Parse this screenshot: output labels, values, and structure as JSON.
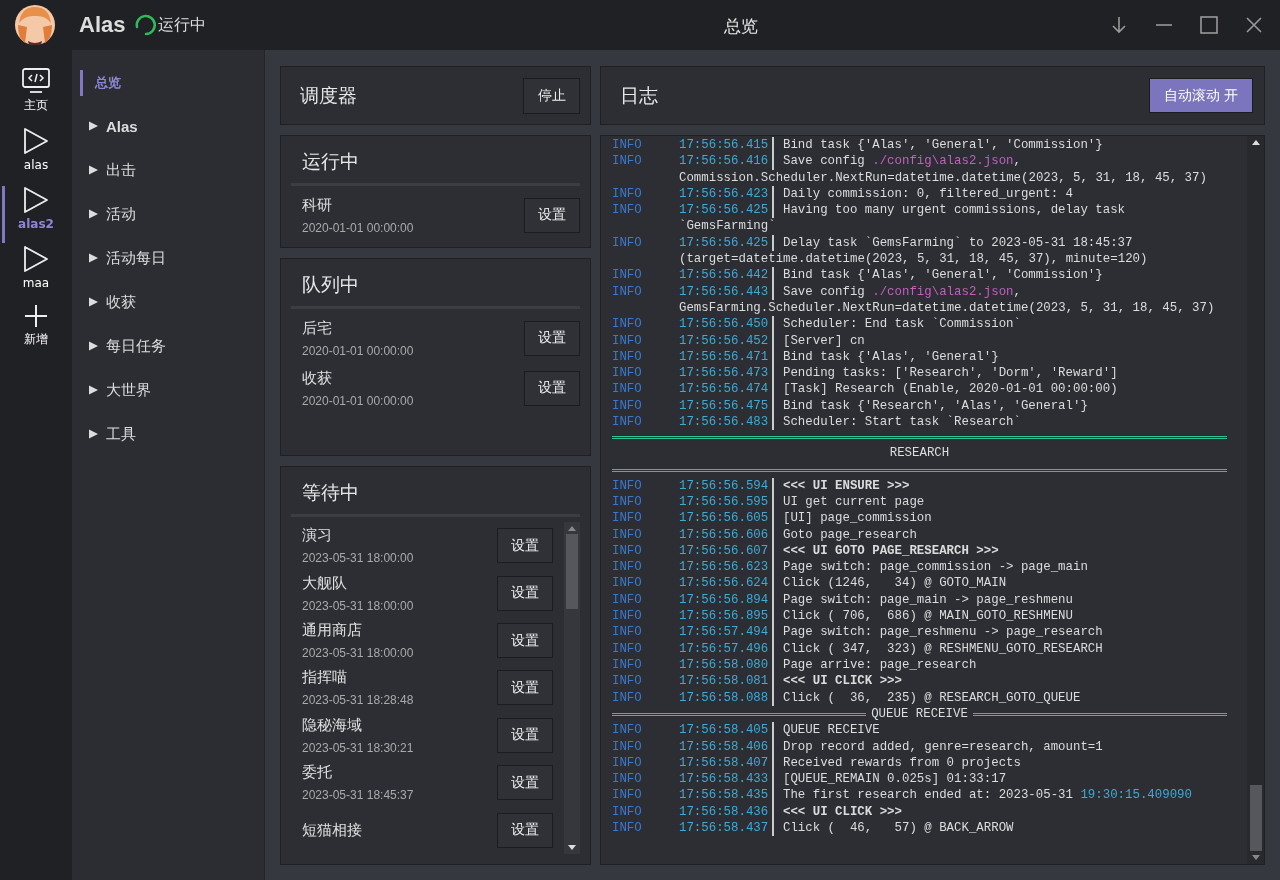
{
  "app": {
    "name": "Alas",
    "status": "运行中",
    "running": true
  },
  "window": {
    "title": "总览"
  },
  "rail": [
    {
      "label": "主页",
      "kind": "home",
      "selected": false
    },
    {
      "label": "alas",
      "kind": "instance",
      "selected": false
    },
    {
      "label": "alas2",
      "kind": "instance",
      "selected": true
    },
    {
      "label": "maa",
      "kind": "instance",
      "selected": false
    },
    {
      "label": "新增",
      "kind": "add",
      "selected": false
    }
  ],
  "nav": [
    {
      "label": "总览",
      "kind": "page",
      "selected": true
    },
    {
      "label": "Alas",
      "kind": "group",
      "selected": false
    },
    {
      "label": "出击",
      "kind": "group",
      "selected": false
    },
    {
      "label": "活动",
      "kind": "group",
      "selected": false
    },
    {
      "label": "活动每日",
      "kind": "group",
      "selected": false
    },
    {
      "label": "收获",
      "kind": "group",
      "selected": false
    },
    {
      "label": "每日任务",
      "kind": "group",
      "selected": false
    },
    {
      "label": "大世界",
      "kind": "group",
      "selected": false
    },
    {
      "label": "工具",
      "kind": "group",
      "selected": false
    }
  ],
  "scheduler": {
    "title": "调度器",
    "button": "停止"
  },
  "running": {
    "title": "运行中",
    "tasks": [
      {
        "name": "科研",
        "time": "2020-01-01 00:00:00",
        "button": "设置"
      }
    ]
  },
  "pending": {
    "title": "队列中",
    "tasks": [
      {
        "name": "后宅",
        "time": "2020-01-01 00:00:00",
        "button": "设置"
      },
      {
        "name": "收获",
        "time": "2020-01-01 00:00:00",
        "button": "设置"
      }
    ]
  },
  "waiting": {
    "title": "等待中",
    "tasks": [
      {
        "name": "演习",
        "time": "2023-05-31 18:00:00",
        "button": "设置"
      },
      {
        "name": "大舰队",
        "time": "2023-05-31 18:00:00",
        "button": "设置"
      },
      {
        "name": "通用商店",
        "time": "2023-05-31 18:00:00",
        "button": "设置"
      },
      {
        "name": "指挥喵",
        "time": "2023-05-31 18:28:48",
        "button": "设置"
      },
      {
        "name": "隐秘海域",
        "time": "2023-05-31 18:30:21",
        "button": "设置"
      },
      {
        "name": "委托",
        "time": "2023-05-31 18:45:37",
        "button": "设置"
      },
      {
        "name": "短猫相接",
        "button": "设置"
      }
    ]
  },
  "log": {
    "title": "日志",
    "autoscroll_button": "自动滚动 开",
    "autoscroll": true,
    "entries": [
      {
        "kind": "line",
        "level": "INFO",
        "time": "17:56:56.415",
        "message": [
          {
            "text": "Bind task {'Alas', 'General', 'Commission'}"
          }
        ]
      },
      {
        "kind": "line",
        "level": "INFO",
        "time": "17:56:56.416",
        "message": [
          {
            "text": "Save config "
          },
          {
            "text": "./config\\alas2.json",
            "kind": "path"
          },
          {
            "text": ","
          }
        ],
        "wrap": "Commission.Scheduler.NextRun=datetime.datetime(2023, 5, 31, 18, 45, 37)"
      },
      {
        "kind": "line",
        "level": "INFO",
        "time": "17:56:56.423",
        "message": [
          {
            "text": "Daily commission: 0, filtered_urgent: 4"
          }
        ]
      },
      {
        "kind": "line",
        "level": "INFO",
        "time": "17:56:56.425",
        "message": [
          {
            "text": "Having too many urgent commissions, delay task"
          }
        ],
        "wrap": "`GemsFarming`"
      },
      {
        "kind": "line",
        "level": "INFO",
        "time": "17:56:56.425",
        "message": [
          {
            "text": "Delay task `GemsFarming` to 2023-05-31 18:45:37"
          }
        ],
        "wrap": "(target=datetime.datetime(2023, 5, 31, 18, 45, 37), minute=120)"
      },
      {
        "kind": "line",
        "level": "INFO",
        "time": "17:56:56.442",
        "message": [
          {
            "text": "Bind task {'Alas', 'General', 'Commission'}"
          }
        ]
      },
      {
        "kind": "line",
        "level": "INFO",
        "time": "17:56:56.443",
        "message": [
          {
            "text": "Save config "
          },
          {
            "text": "./config\\alas2.json",
            "kind": "path"
          },
          {
            "text": ","
          }
        ],
        "wrap": "GemsFarming.Scheduler.NextRun=datetime.datetime(2023, 5, 31, 18, 45, 37)"
      },
      {
        "kind": "line",
        "level": "INFO",
        "time": "17:56:56.450",
        "message": [
          {
            "text": "Scheduler: End task `Commission`"
          }
        ]
      },
      {
        "kind": "line",
        "level": "INFO",
        "time": "17:56:56.452",
        "message": [
          {
            "text": "[Server] cn"
          }
        ]
      },
      {
        "kind": "line",
        "level": "INFO",
        "time": "17:56:56.471",
        "message": [
          {
            "text": "Bind task {'Alas', 'General'}"
          }
        ]
      },
      {
        "kind": "line",
        "level": "INFO",
        "time": "17:56:56.473",
        "message": [
          {
            "text": "Pending tasks: ['Research', 'Dorm', 'Reward']"
          }
        ]
      },
      {
        "kind": "line",
        "level": "INFO",
        "time": "17:56:56.474",
        "message": [
          {
            "text": "[Task] Research (Enable, 2020-01-01 00:00:00)"
          }
        ]
      },
      {
        "kind": "line",
        "level": "INFO",
        "time": "17:56:56.475",
        "message": [
          {
            "text": "Bind task {'Research', 'Alas', 'General'}"
          }
        ]
      },
      {
        "kind": "line",
        "level": "INFO",
        "time": "17:56:56.483",
        "message": [
          {
            "text": "Scheduler: Start task `Research`"
          }
        ]
      },
      {
        "kind": "banner",
        "title": "RESEARCH"
      },
      {
        "kind": "line",
        "level": "INFO",
        "time": "17:56:56.594",
        "bold": true,
        "message": [
          {
            "text": "<<< UI ENSURE >>>"
          }
        ]
      },
      {
        "kind": "line",
        "level": "INFO",
        "time": "17:56:56.595",
        "message": [
          {
            "text": "UI get current page"
          }
        ]
      },
      {
        "kind": "line",
        "level": "INFO",
        "time": "17:56:56.605",
        "message": [
          {
            "text": "[UI] page_commission"
          }
        ]
      },
      {
        "kind": "line",
        "level": "INFO",
        "time": "17:56:56.606",
        "message": [
          {
            "text": "Goto page_research"
          }
        ]
      },
      {
        "kind": "line",
        "level": "INFO",
        "time": "17:56:56.607",
        "bold": true,
        "message": [
          {
            "text": "<<< UI GOTO PAGE_RESEARCH >>>"
          }
        ]
      },
      {
        "kind": "line",
        "level": "INFO",
        "time": "17:56:56.623",
        "message": [
          {
            "text": "Page switch: page_commission -> page_main"
          }
        ]
      },
      {
        "kind": "line",
        "level": "INFO",
        "time": "17:56:56.624",
        "message": [
          {
            "text": "Click (1246,   34) @ GOTO_MAIN"
          }
        ]
      },
      {
        "kind": "line",
        "level": "INFO",
        "time": "17:56:56.894",
        "message": [
          {
            "text": "Page switch: page_main -> page_reshmenu"
          }
        ]
      },
      {
        "kind": "line",
        "level": "INFO",
        "time": "17:56:56.895",
        "message": [
          {
            "text": "Click ( 706,  686) @ MAIN_GOTO_RESHMENU"
          }
        ]
      },
      {
        "kind": "line",
        "level": "INFO",
        "time": "17:56:57.494",
        "message": [
          {
            "text": "Page switch: page_reshmenu -> page_research"
          }
        ]
      },
      {
        "kind": "line",
        "level": "INFO",
        "time": "17:56:57.496",
        "message": [
          {
            "text": "Click ( 347,  323) @ RESHMENU_GOTO_RESEARCH"
          }
        ]
      },
      {
        "kind": "line",
        "level": "INFO",
        "time": "17:56:58.080",
        "message": [
          {
            "text": "Page arrive: page_research"
          }
        ]
      },
      {
        "kind": "line",
        "level": "INFO",
        "time": "17:56:58.081",
        "bold": true,
        "message": [
          {
            "text": "<<< UI CLICK >>>"
          }
        ]
      },
      {
        "kind": "line",
        "level": "INFO",
        "time": "17:56:58.088",
        "message": [
          {
            "text": "Click (  36,  235) @ RESEARCH_GOTO_QUEUE"
          }
        ]
      },
      {
        "kind": "divider",
        "title": "QUEUE RECEIVE"
      },
      {
        "kind": "line",
        "level": "INFO",
        "time": "17:56:58.405",
        "message": [
          {
            "text": "QUEUE RECEIVE"
          }
        ]
      },
      {
        "kind": "line",
        "level": "INFO",
        "time": "17:56:58.406",
        "message": [
          {
            "text": "Drop record added, genre=research, amount=1"
          }
        ]
      },
      {
        "kind": "line",
        "level": "INFO",
        "time": "17:56:58.407",
        "message": [
          {
            "text": "Received rewards from 0 projects"
          }
        ]
      },
      {
        "kind": "line",
        "level": "INFO",
        "time": "17:56:58.433",
        "message": [
          {
            "text": "[QUEUE_REMAIN 0.025s] 01:33:17"
          }
        ]
      },
      {
        "kind": "line",
        "level": "INFO",
        "time": "17:56:58.435",
        "message": [
          {
            "text": "The first research ended at: 2023-05-31 "
          },
          {
            "text": "19:30:15.409090",
            "kind": "time"
          }
        ]
      },
      {
        "kind": "line",
        "level": "INFO",
        "time": "17:56:58.436",
        "bold": true,
        "message": [
          {
            "text": "<<< UI CLICK >>>"
          }
        ]
      },
      {
        "kind": "line",
        "level": "INFO",
        "time": "17:56:58.437",
        "message": [
          {
            "text": "Click (  46,   57) @ BACK_ARROW"
          }
        ]
      }
    ]
  }
}
